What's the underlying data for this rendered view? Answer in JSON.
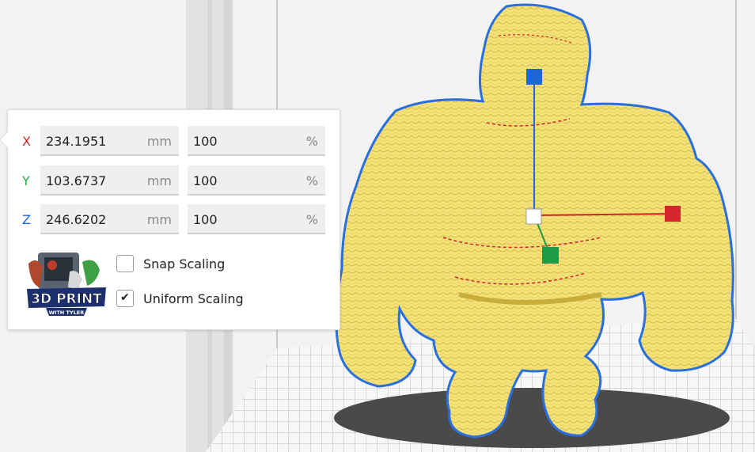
{
  "scale_panel": {
    "axes": [
      {
        "axis": "X",
        "size": "234.1951",
        "size_unit": "mm",
        "percent": "100",
        "percent_unit": "%",
        "color": "#d2252d"
      },
      {
        "axis": "Y",
        "size": "103.6737",
        "size_unit": "mm",
        "percent": "100",
        "percent_unit": "%",
        "color": "#2ea84a"
      },
      {
        "axis": "Z",
        "size": "246.6202",
        "size_unit": "mm",
        "percent": "100",
        "percent_unit": "%",
        "color": "#1f67d8"
      }
    ],
    "snap_scaling": {
      "label": "Snap Scaling",
      "checked": false
    },
    "uniform_scaling": {
      "label": "Uniform Scaling",
      "checked": true,
      "tick": "✔"
    },
    "logo": {
      "line1": "3D PRINT",
      "line2": "WITH TYLER"
    }
  },
  "viewport": {
    "model_color": "#f5e27a",
    "outline_color": "#2a6fe0",
    "handles": {
      "x_color": "#d2252d",
      "y_color": "#1f9a46",
      "z_color": "#1f67d8"
    }
  }
}
